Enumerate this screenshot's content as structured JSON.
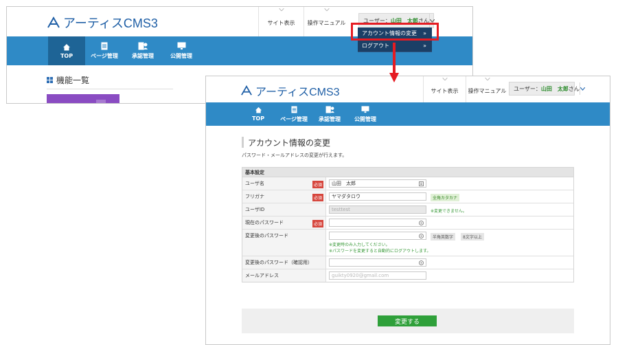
{
  "brand": {
    "logo_text": "アーティスCMS3"
  },
  "header": {
    "site_view": "サイト表示",
    "manual": "操作マニュアル",
    "user_prefix": "ユーザー：",
    "user_name": "山田　太郎",
    "user_suffix": "さん"
  },
  "nav": {
    "top": "TOP",
    "pages": "ページ管理",
    "approval": "承認管理",
    "publish": "公開管理"
  },
  "dropdown": {
    "account": "アカウント情報の変更",
    "logout": "ログアウト",
    "arrow": "»"
  },
  "dashboard": {
    "title": "機能一覧"
  },
  "page": {
    "title": "アカウント情報の変更",
    "description": "パスワード・メールアドレスの変更が行えます。"
  },
  "form": {
    "section": "基本設定",
    "required": "必須",
    "rows": {
      "username": {
        "label": "ユーザ名",
        "value": "山田　太郎"
      },
      "furigana": {
        "label": "フリガナ",
        "value": "ヤマダタロウ",
        "tag": "全角カタカナ"
      },
      "userid": {
        "label": "ユーザID",
        "value": "testtest",
        "note": "※変更できません。"
      },
      "current_pw": {
        "label": "現在のパスワード"
      },
      "new_pw": {
        "label": "変更後のパスワード",
        "tag1": "半角英数字",
        "tag2": "8文字以上",
        "note1": "※変更時のみ入力してください。",
        "note2": "※パスワードを変更すると自動的にログアウトします。"
      },
      "confirm_pw": {
        "label": "変更後のパスワード（確認用）"
      },
      "email": {
        "label": "メールアドレス",
        "value": "guikty0920@gmail.com"
      }
    },
    "submit": "変更する"
  },
  "colors": {
    "nav_blue": "#2f8ac6",
    "nav_active": "#1e6496",
    "dropdown_bg": "#1b3f66",
    "highlight_red": "#e51c23",
    "submit_green": "#2fa03a",
    "required_red": "#d6453c"
  }
}
